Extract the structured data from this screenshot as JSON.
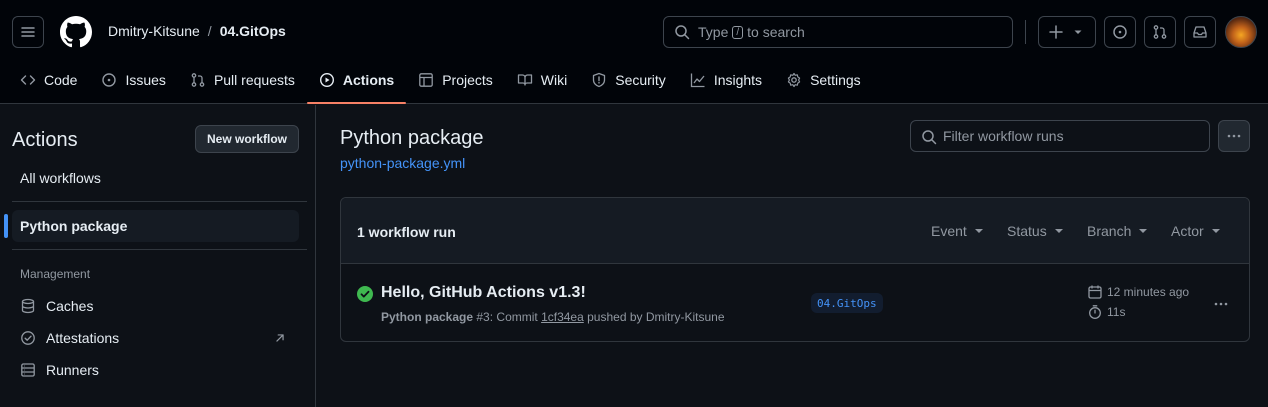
{
  "header": {
    "owner": "Dmitry-Kitsune",
    "separator": "/",
    "repo": "04.GitOps",
    "search_prefix": "Type",
    "search_key": "/",
    "search_suffix": "to search"
  },
  "tabs": [
    {
      "label": "Code",
      "icon": "code-icon"
    },
    {
      "label": "Issues",
      "icon": "issue-icon"
    },
    {
      "label": "Pull requests",
      "icon": "pull-request-icon"
    },
    {
      "label": "Actions",
      "icon": "play-icon",
      "active": true
    },
    {
      "label": "Projects",
      "icon": "table-icon"
    },
    {
      "label": "Wiki",
      "icon": "book-icon"
    },
    {
      "label": "Security",
      "icon": "shield-icon"
    },
    {
      "label": "Insights",
      "icon": "graph-icon"
    },
    {
      "label": "Settings",
      "icon": "gear-icon"
    }
  ],
  "sidebar": {
    "title": "Actions",
    "new_workflow": "New workflow",
    "all_workflows": "All workflows",
    "active_workflow": "Python package",
    "management_heading": "Management",
    "management_items": [
      {
        "label": "Caches",
        "icon": "database-icon"
      },
      {
        "label": "Attestations",
        "icon": "verified-icon"
      },
      {
        "label": "Runners",
        "icon": "server-icon"
      }
    ]
  },
  "main": {
    "title": "Python package",
    "file": "python-package.yml",
    "filter_placeholder": "Filter workflow runs",
    "runs_count": "1 workflow run",
    "filters": [
      "Event",
      "Status",
      "Branch",
      "Actor"
    ],
    "run": {
      "title": "Hello, GitHub Actions v1.3!",
      "workflow": "Python package",
      "number": "#3",
      "commit_prefix": ": Commit",
      "commit": "1cf34ea",
      "pushed_by": "pushed by Dmitry-Kitsune",
      "branch": "04.GitOps",
      "time_ago": "12 minutes ago",
      "duration": "11s",
      "status_color": "#3fb950"
    }
  },
  "colors": {
    "accent": "#4493f8",
    "active_tab_underline": "#f78166",
    "success": "#3fb950"
  }
}
